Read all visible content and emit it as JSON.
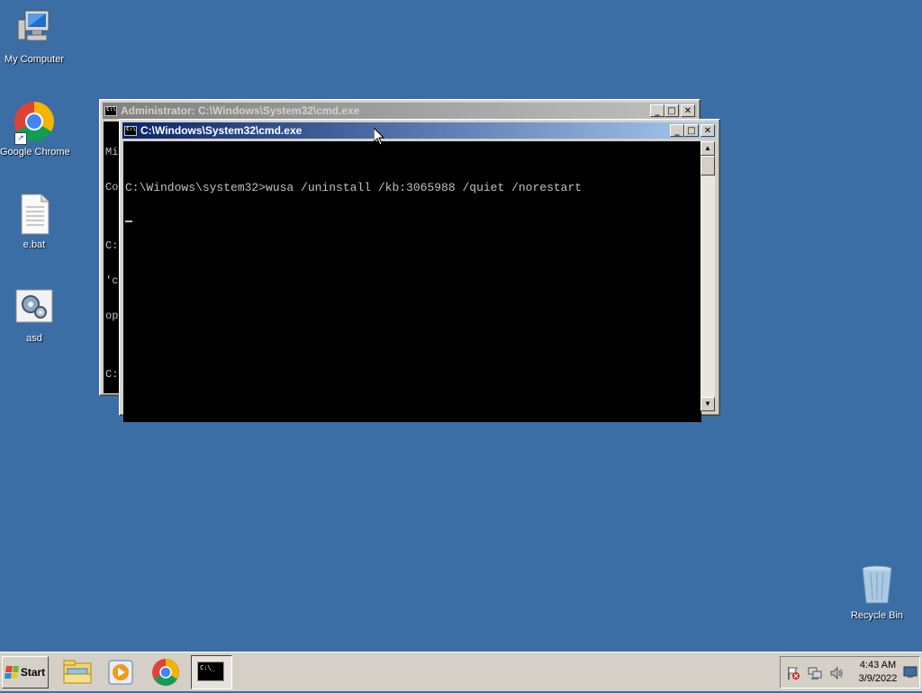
{
  "desktop": {
    "icons": [
      {
        "label": "My Computer"
      },
      {
        "label": "Google Chrome"
      },
      {
        "label": "e.bat"
      },
      {
        "label": "asd"
      },
      {
        "label": "Recycle Bin"
      }
    ]
  },
  "windows": {
    "back": {
      "title": "Administrator: C:\\Windows\\System32\\cmd.exe",
      "visible_lines": [
        "Mi",
        "Co",
        "",
        "C:",
        "'c",
        "op",
        "",
        "C:"
      ]
    },
    "front": {
      "title": "C:\\Windows\\System32\\cmd.exe",
      "console_text": "C:\\Windows\\system32>wusa /uninstall /kb:3065988 /quiet /norestart"
    }
  },
  "taskbar": {
    "start_label": "Start",
    "quick_launch": [
      "explorer-icon",
      "media-player-icon",
      "chrome-icon"
    ],
    "active_task_icon": "cmd-icon",
    "tray_icons": [
      "action-center-flag-icon",
      "network-icon",
      "volume-icon"
    ],
    "clock": {
      "time": "4:43 AM",
      "date": "3/9/2022"
    }
  },
  "colors": {
    "desktop": "#3a6ea5",
    "title_active": "#0a246a",
    "title_inactive": "#808080",
    "console_bg": "#000000",
    "console_fg": "#c0c0c0"
  }
}
